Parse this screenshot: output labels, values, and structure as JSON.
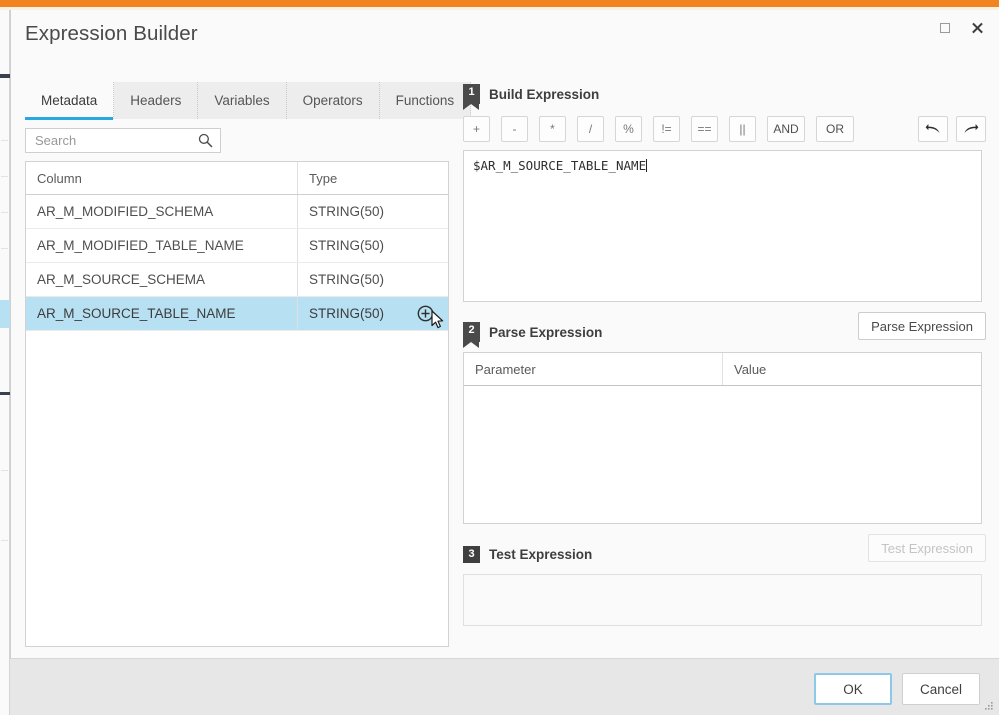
{
  "theme": {
    "accent_orange": "#f28321",
    "accent_blue": "#27a8e0",
    "selection_blue": "#b7e0f2"
  },
  "window": {
    "title": "Expression Builder",
    "maximize_icon": "maximize-icon",
    "close_icon": "close-icon"
  },
  "left_panel": {
    "tabs": [
      {
        "label": "Metadata",
        "active": true
      },
      {
        "label": "Headers",
        "active": false
      },
      {
        "label": "Variables",
        "active": false
      },
      {
        "label": "Operators",
        "active": false
      },
      {
        "label": "Functions",
        "active": false
      }
    ],
    "search": {
      "value": "",
      "placeholder": "Search",
      "icon": "search-icon"
    },
    "grid": {
      "columns": [
        "Column",
        "Type"
      ],
      "rows": [
        {
          "name": "AR_M_MODIFIED_SCHEMA",
          "type": "STRING(50)",
          "selected": false
        },
        {
          "name": "AR_M_MODIFIED_TABLE_NAME",
          "type": "STRING(50)",
          "selected": false
        },
        {
          "name": "AR_M_SOURCE_SCHEMA",
          "type": "STRING(50)",
          "selected": false
        },
        {
          "name": "AR_M_SOURCE_TABLE_NAME",
          "type": "STRING(50)",
          "selected": true
        }
      ],
      "row_action_icon": "add-circle-icon"
    }
  },
  "right_panel": {
    "step1": {
      "number": "1",
      "title": "Build Expression",
      "operators": [
        "+",
        "-",
        "*",
        "/",
        "%",
        "!=",
        "==",
        "||",
        "AND",
        "OR"
      ],
      "undo_icon": "undo-arrow-icon",
      "redo_icon": "redo-arrow-icon",
      "expression": "$AR_M_SOURCE_TABLE_NAME"
    },
    "step2": {
      "number": "2",
      "title": "Parse Expression",
      "button_label": "Parse Expression",
      "table": {
        "columns": [
          "Parameter",
          "Value"
        ],
        "rows": []
      }
    },
    "step3": {
      "number": "3",
      "title": "Test Expression",
      "button_label": "Test Expression",
      "button_disabled": true,
      "result": ""
    }
  },
  "footer": {
    "ok_label": "OK",
    "cancel_label": "Cancel",
    "resize_grip_icon": "resize-grip-icon"
  }
}
